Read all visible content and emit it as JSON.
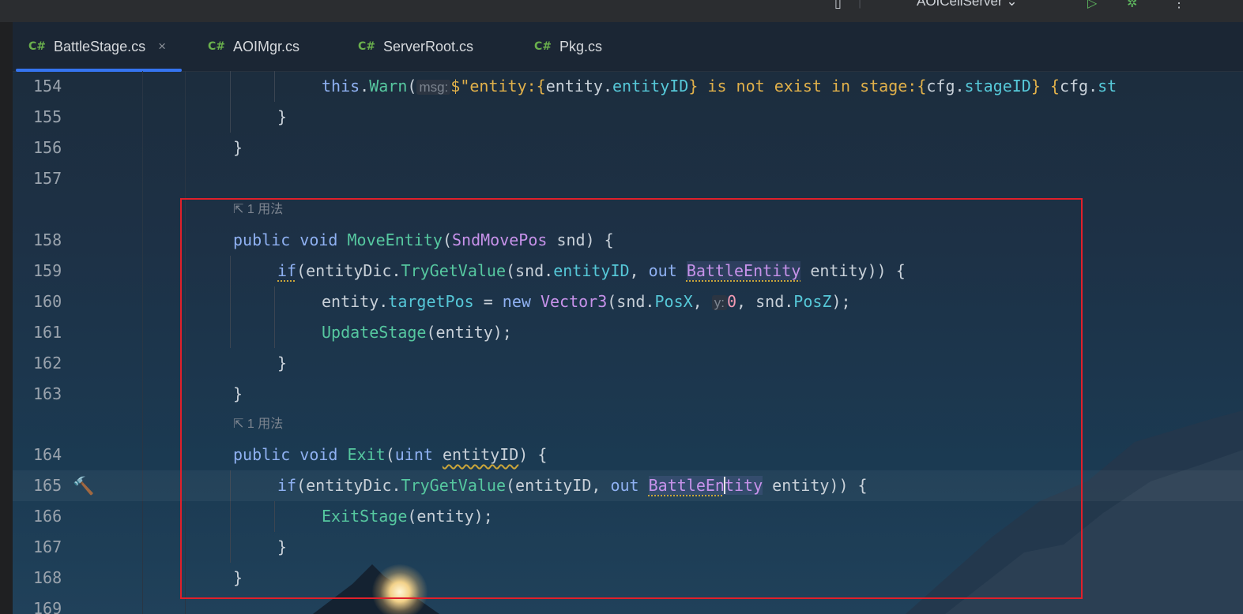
{
  "topbar": {
    "run_config": "AOICellServer",
    "dropdown_glyph": "⌄"
  },
  "tabs": [
    {
      "lang": "C#",
      "label": "BattleStage.cs",
      "active": true,
      "close": "×"
    },
    {
      "lang": "C#",
      "label": "AOIMgr.cs",
      "active": false
    },
    {
      "lang": "C#",
      "label": "ServerRoot.cs",
      "active": false
    },
    {
      "lang": "C#",
      "label": "Pkg.cs",
      "active": false
    }
  ],
  "usage_hint": "1 用法",
  "lines": {
    "l154": {
      "num": "154",
      "a": "this",
      "b": ".",
      "c": "Warn",
      "d": "(",
      "hint": "msg:",
      "e": "$\"entity:{",
      "f": "entity",
      "g": ".",
      "h": "entityID",
      "i": "} is not exist in stage:{",
      "j": "cfg",
      "k": ".",
      "l": "stageID",
      "m": "} {",
      "n": "cfg",
      "o": ".",
      "p": "st"
    },
    "l155": {
      "num": "155",
      "t": "}"
    },
    "l156": {
      "num": "156",
      "t": "}"
    },
    "l157": {
      "num": "157"
    },
    "l158": {
      "num": "158",
      "a": "public",
      "b": "void",
      "c": "MoveEntity",
      "d": "(",
      "e": "SndMovePos",
      "f": " snd) {"
    },
    "l159": {
      "num": "159",
      "a": "if",
      "b": "(entityDic.",
      "c": "TryGetValue",
      "d": "(snd.",
      "e": "entityID",
      "f": ", ",
      "g": "out",
      "h": "BattleEntity",
      "i": " entity)) {"
    },
    "l160": {
      "num": "160",
      "a": "entity.",
      "b": "targetPos",
      "c": " = ",
      "d": "new",
      "e": "Vector3",
      "f": "(snd.",
      "g": "PosX",
      "h": ", ",
      "hint": "y:",
      "i": "0",
      "j": ", snd.",
      "k": "PosZ",
      "l": ");"
    },
    "l161": {
      "num": "161",
      "a": "UpdateStage",
      "b": "(entity);"
    },
    "l162": {
      "num": "162",
      "t": "}"
    },
    "l163": {
      "num": "163",
      "t": "}"
    },
    "l164": {
      "num": "164",
      "a": "public",
      "b": "void",
      "c": "Exit",
      "d": "(",
      "e": "uint",
      "f": "entityID",
      "g": ") {"
    },
    "l165": {
      "num": "165",
      "a": "if",
      "b": "(entityDic.",
      "c": "TryGetValue",
      "d": "(entityID, ",
      "e": "out",
      "f1": "BattleEn",
      "f2": "tity",
      "g": " entity)) {"
    },
    "l166": {
      "num": "166",
      "a": "ExitStage",
      "b": "(entity);"
    },
    "l167": {
      "num": "167",
      "t": "}"
    },
    "l168": {
      "num": "168",
      "t": "}"
    },
    "l169": {
      "num": "169"
    }
  },
  "icons": {
    "usage": "external-link-icon",
    "gutter": "hammer-icon"
  },
  "colors": {
    "keyword": "#8fb1f2",
    "type": "#c792ea",
    "method": "#56c8a0",
    "property": "#56c8d8",
    "string": "#e0b04a",
    "number": "#f29ab2",
    "highlight_box": "#e0202a",
    "tab_underline": "#3574f0"
  }
}
